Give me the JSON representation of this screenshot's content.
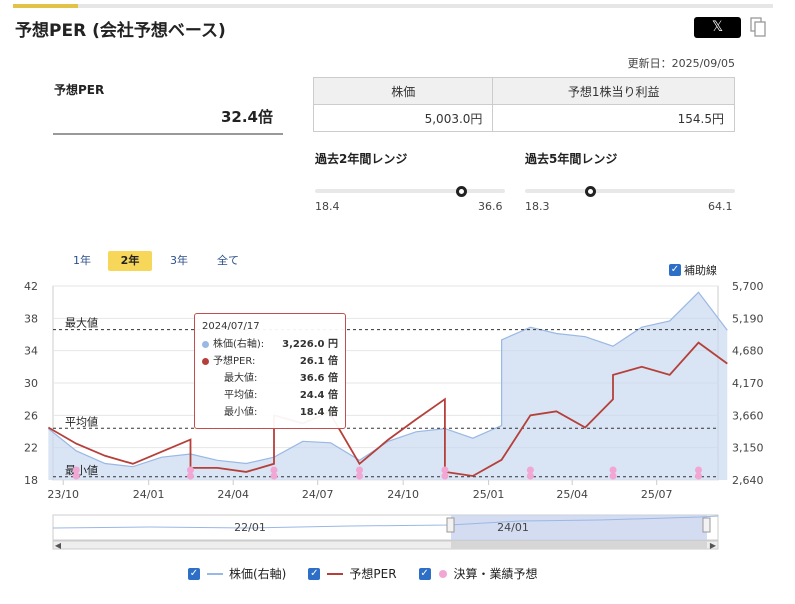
{
  "header": {
    "title": "予想PER (会社予想ベース)",
    "share_x_label": "𝕏",
    "updated": "更新日：2025/09/05"
  },
  "per": {
    "label": "予想PER",
    "value": "32.4倍"
  },
  "metrics": {
    "price_header": "株価",
    "eps_header": "予想1株当り利益",
    "price_value": "5,003.0円",
    "eps_value": "154.5円"
  },
  "ranges": {
    "two_year": {
      "label": "過去2年間レンジ",
      "min": "18.4",
      "max": "36.6",
      "current": 32.4
    },
    "five_year": {
      "label": "過去5年間レンジ",
      "min": "18.3",
      "max": "64.1",
      "current": 32.4
    }
  },
  "period_tabs": [
    "1年",
    "2年",
    "3年",
    "全て"
  ],
  "active_tab": "2年",
  "aux_lines": {
    "label": "補助線",
    "checked": true
  },
  "tooltip": {
    "date": "2024/07/17",
    "price_label": "株価(右軸):",
    "price_value": "3,226.0 円",
    "per_label": "予想PER:",
    "per_value": "26.1 倍",
    "max_label": "最大値:",
    "max_value": "36.6 倍",
    "avg_label": "平均値:",
    "avg_value": "24.4 倍",
    "min_label": "最小値:",
    "min_value": "18.4 倍"
  },
  "legend": {
    "price": "株価(右軸)",
    "per": "予想PER",
    "earnings": "決算・業績予想"
  },
  "colors": {
    "per_line": "#b5403a",
    "price_line": "#9ab8e4",
    "price_fill": "#c9d8f0",
    "earnings_dot": "#f2a6d3",
    "accent": "#f7d75a",
    "checkbox": "#2d6fc6"
  },
  "chart_data": {
    "type": "line",
    "title": "",
    "y_left": {
      "ticks": [
        "42",
        "38",
        "34",
        "30",
        "26",
        "22",
        "18"
      ],
      "range": [
        18,
        42
      ]
    },
    "y_right": {
      "ticks": [
        "5,700",
        "5,190",
        "4,680",
        "4,170",
        "3,660",
        "3,150",
        "2,640"
      ],
      "range": [
        2640,
        5700
      ]
    },
    "x_ticks": [
      "23/10",
      "24/01",
      "24/04",
      "24/07",
      "24/10",
      "25/01",
      "25/04",
      "25/07"
    ],
    "navigator_ticks": [
      "22/01",
      "24/01"
    ],
    "reference_lines": [
      {
        "label": "最大値",
        "value": 36.6
      },
      {
        "label": "平均値",
        "value": 24.4
      },
      {
        "label": "最小値",
        "value": 18.4
      }
    ],
    "series": [
      {
        "name": "予想PER",
        "axis": "left",
        "x": [
          "2023/09",
          "2023/10",
          "2023/11",
          "2023/12",
          "2024/01",
          "2024/02",
          "2024/02",
          "2024/03",
          "2024/04",
          "2024/05",
          "2024/05",
          "2024/06",
          "2024/07",
          "2024/07",
          "2024/08",
          "2024/09",
          "2024/10",
          "2024/11",
          "2024/11",
          "2024/12",
          "2025/01",
          "2025/02",
          "2025/03",
          "2025/04",
          "2025/05",
          "2025/05",
          "2025/06",
          "2025/07",
          "2025/08",
          "2025/09"
        ],
        "values": [
          24.5,
          22.5,
          21.0,
          20.0,
          21.5,
          23.0,
          19.5,
          19.5,
          19.0,
          20.0,
          26.0,
          25.0,
          26.5,
          26.1,
          20.0,
          23.0,
          25.5,
          28.0,
          19.0,
          18.5,
          20.5,
          26.0,
          26.5,
          24.5,
          28.0,
          31.0,
          32.0,
          31.0,
          35.0,
          32.4
        ]
      },
      {
        "name": "株価(右軸)",
        "axis": "right",
        "x": [
          "2023/09",
          "2023/10",
          "2023/11",
          "2023/12",
          "2024/01",
          "2024/02",
          "2024/03",
          "2024/04",
          "2024/05",
          "2024/06",
          "2024/07",
          "2024/08",
          "2024/09",
          "2024/10",
          "2024/11",
          "2024/12",
          "2025/01",
          "2025/01",
          "2025/02",
          "2025/03",
          "2025/04",
          "2025/05",
          "2025/06",
          "2025/07",
          "2025/08",
          "2025/09"
        ],
        "values": [
          3450,
          3100,
          2900,
          2850,
          3000,
          3050,
          2950,
          2900,
          3000,
          3250,
          3226,
          2950,
          3250,
          3400,
          3450,
          3300,
          3500,
          4850,
          5050,
          4950,
          4900,
          4750,
          5050,
          5150,
          5600,
          5003
        ]
      }
    ],
    "earnings_markers_x": [
      "2023/10",
      "2024/02",
      "2024/05",
      "2024/08",
      "2024/11",
      "2025/02",
      "2025/05",
      "2025/08"
    ]
  }
}
